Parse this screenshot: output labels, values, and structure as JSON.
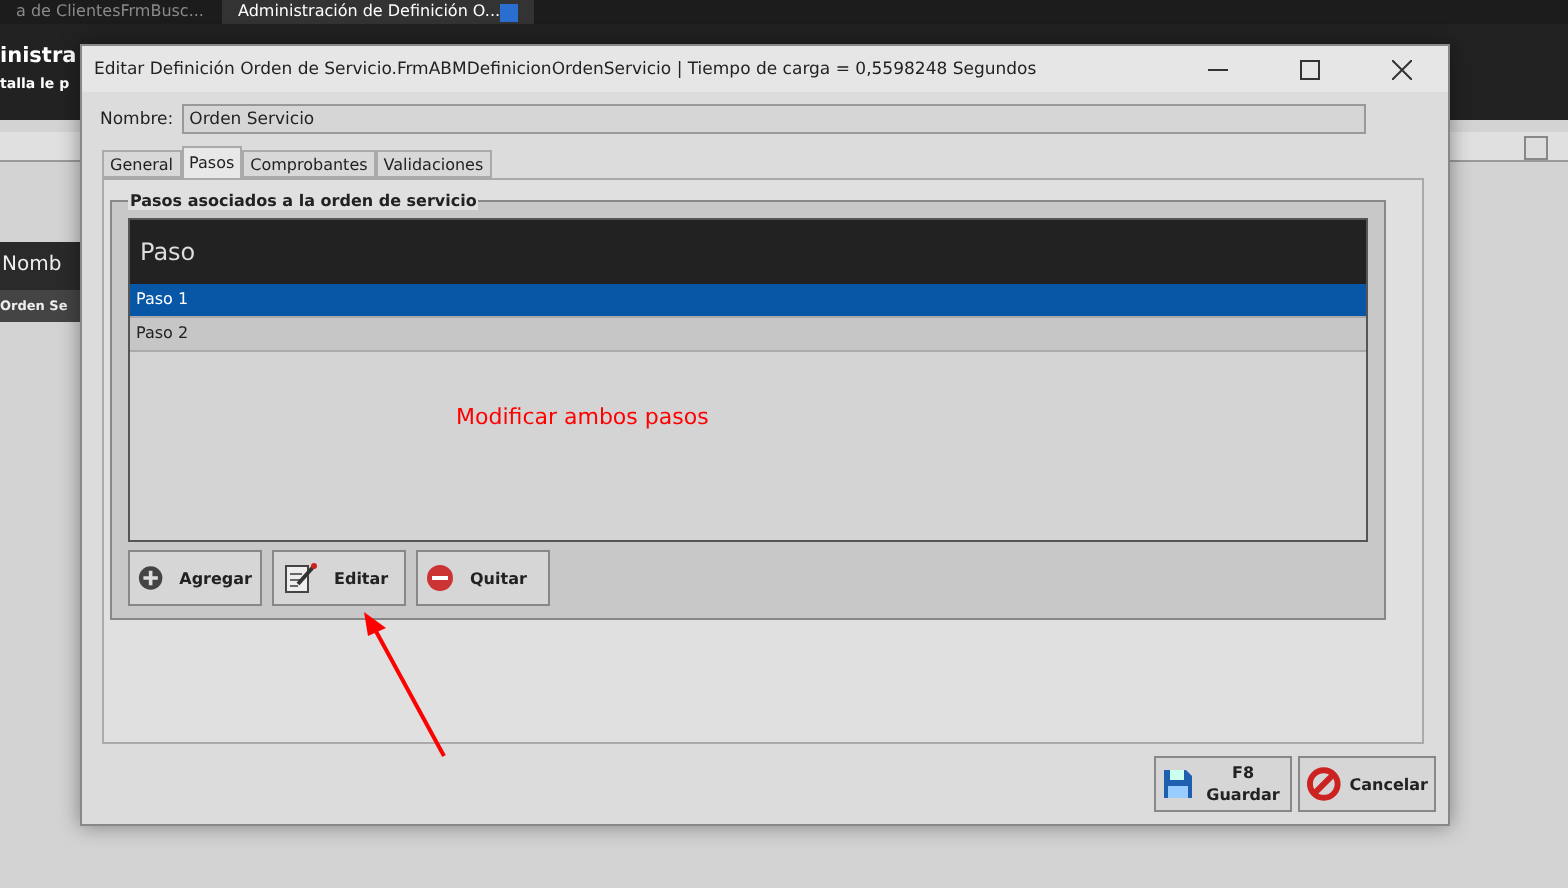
{
  "app_tabs": [
    {
      "label": "a de ClientesFrmBusc...",
      "selected": false
    },
    {
      "label": "Administración de Definición O...",
      "selected": true
    }
  ],
  "app_header": {
    "title": "inistra",
    "subtitle": "talla le p"
  },
  "app_list": {
    "column": "Nomb",
    "row": "Orden Se"
  },
  "dialog": {
    "title": "Editar Definición Orden de Servicio.FrmABMDefinicionOrdenServicio | Tiempo de carga = 0,5598248 Segundos",
    "name_label": "Nombre:",
    "name_value": "Orden Servicio",
    "tabs": [
      {
        "label": "General",
        "selected": false
      },
      {
        "label": "Pasos",
        "selected": true
      },
      {
        "label": "Comprobantes",
        "selected": false
      },
      {
        "label": "Validaciones",
        "selected": false
      }
    ],
    "group_title": "Pasos asociados a la orden de servicio",
    "grid": {
      "column": "Paso",
      "rows": [
        {
          "label": "Paso 1",
          "selected": true
        },
        {
          "label": "Paso 2",
          "selected": false
        }
      ]
    },
    "actions": [
      {
        "kind": "add",
        "label": "Agregar"
      },
      {
        "kind": "edit",
        "label": "Editar"
      },
      {
        "kind": "remove",
        "label": "Quitar"
      }
    ],
    "footer": [
      {
        "kind": "save",
        "key": "F8",
        "label": "Guardar"
      },
      {
        "kind": "cancel",
        "label": "Cancelar"
      }
    ]
  },
  "annotation": {
    "text": "Modificar ambos pasos"
  }
}
